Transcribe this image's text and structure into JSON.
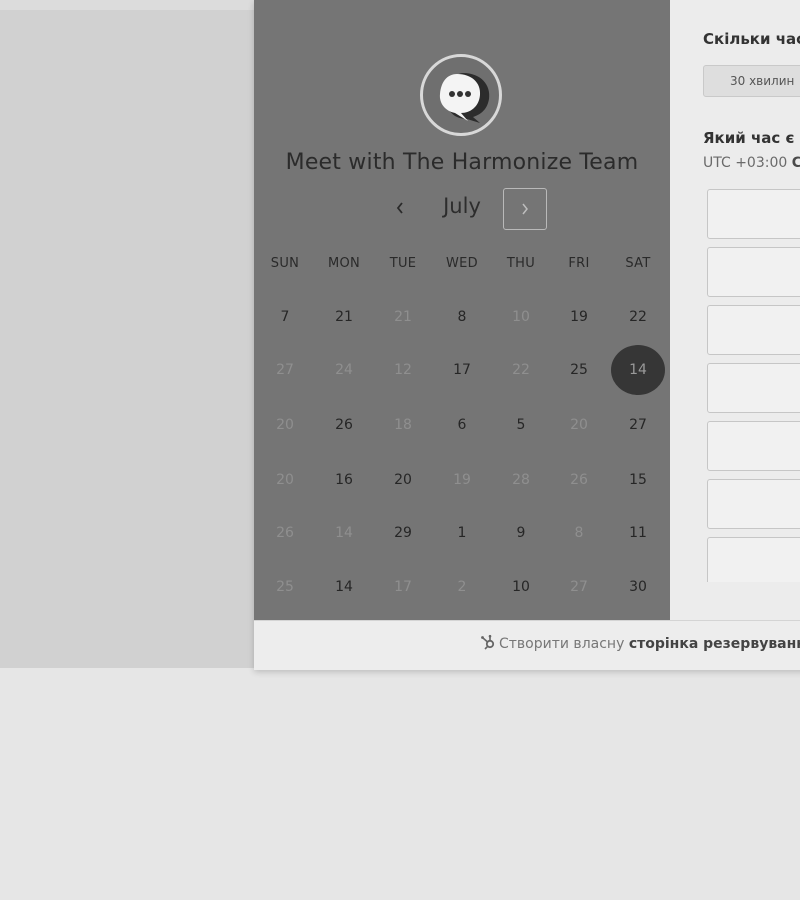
{
  "team_title": "Meet with The Harmonize Team",
  "calendar": {
    "month": "July",
    "weekdays": [
      "SUN",
      "MON",
      "TUE",
      "WED",
      "THU",
      "FRI",
      "SAT"
    ],
    "rows": [
      [
        {
          "d": "7",
          "s": "available"
        },
        {
          "d": "21",
          "s": "available"
        },
        {
          "d": "21",
          "s": "disabled"
        },
        {
          "d": "8",
          "s": "available"
        },
        {
          "d": "10",
          "s": "disabled"
        },
        {
          "d": "19",
          "s": "available"
        },
        {
          "d": "22",
          "s": "available"
        }
      ],
      [
        {
          "d": "27",
          "s": "disabled"
        },
        {
          "d": "24",
          "s": "disabled"
        },
        {
          "d": "12",
          "s": "disabled"
        },
        {
          "d": "17",
          "s": "available"
        },
        {
          "d": "22",
          "s": "disabled"
        },
        {
          "d": "25",
          "s": "available"
        },
        {
          "d": "14",
          "s": "selected"
        }
      ],
      [
        {
          "d": "20",
          "s": "disabled"
        },
        {
          "d": "26",
          "s": "available"
        },
        {
          "d": "18",
          "s": "disabled"
        },
        {
          "d": "6",
          "s": "available"
        },
        {
          "d": "5",
          "s": "available"
        },
        {
          "d": "20",
          "s": "disabled"
        },
        {
          "d": "27",
          "s": "available"
        }
      ],
      [
        {
          "d": "20",
          "s": "disabled"
        },
        {
          "d": "16",
          "s": "available"
        },
        {
          "d": "20",
          "s": "available"
        },
        {
          "d": "19",
          "s": "disabled"
        },
        {
          "d": "28",
          "s": "disabled"
        },
        {
          "d": "26",
          "s": "disabled"
        },
        {
          "d": "15",
          "s": "available"
        }
      ],
      [
        {
          "d": "26",
          "s": "disabled"
        },
        {
          "d": "14",
          "s": "disabled"
        },
        {
          "d": "29",
          "s": "available"
        },
        {
          "d": "1",
          "s": "available"
        },
        {
          "d": "9",
          "s": "available"
        },
        {
          "d": "8",
          "s": "disabled"
        },
        {
          "d": "11",
          "s": "available"
        }
      ],
      [
        {
          "d": "25",
          "s": "disabled"
        },
        {
          "d": "14",
          "s": "available"
        },
        {
          "d": "17",
          "s": "disabled"
        },
        {
          "d": "2",
          "s": "disabled"
        },
        {
          "d": "10",
          "s": "available"
        },
        {
          "d": "27",
          "s": "disabled"
        },
        {
          "d": "30",
          "s": "available"
        }
      ]
    ]
  },
  "booking": {
    "duration_question": "Скільки час",
    "duration_option": "30 хвилин",
    "time_question": "Який час є н",
    "timezone_prefix": "UTC +03:00",
    "timezone_bold": "С",
    "slot_count": 7
  },
  "footer": {
    "text_plain": "Створити власну",
    "text_bold": "сторінка резервування зу"
  },
  "icons": {
    "logo": "chat-bubble-icon",
    "prev": "chevron-left-icon",
    "next": "chevron-right-icon",
    "footer": "hubspot-sprocket-icon"
  }
}
